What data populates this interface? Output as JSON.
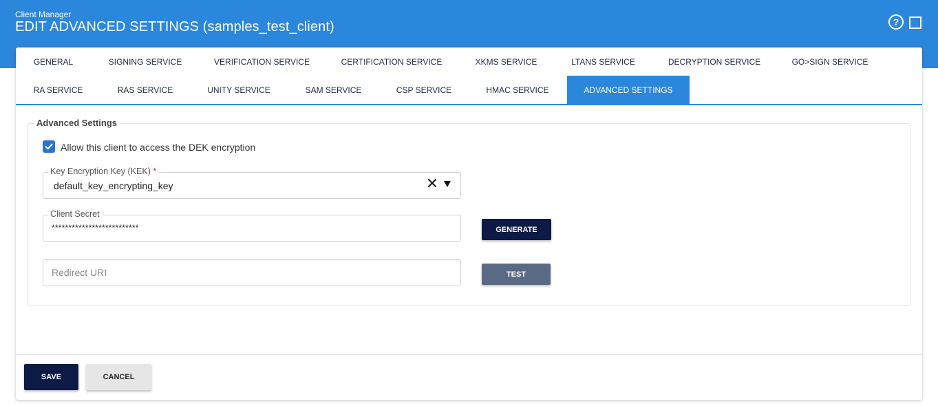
{
  "header": {
    "app_name": "Client Manager",
    "title": "EDIT ADVANCED SETTINGS (samples_test_client)",
    "help_icon": "?"
  },
  "tabs": [
    {
      "label": "GENERAL"
    },
    {
      "label": "SIGNING SERVICE"
    },
    {
      "label": "VERIFICATION SERVICE"
    },
    {
      "label": "CERTIFICATION SERVICE"
    },
    {
      "label": "XKMS SERVICE"
    },
    {
      "label": "LTANS SERVICE"
    },
    {
      "label": "DECRYPTION SERVICE"
    },
    {
      "label": "GO>SIGN SERVICE"
    },
    {
      "label": "RA SERVICE"
    },
    {
      "label": "RAS SERVICE"
    },
    {
      "label": "UNITY SERVICE"
    },
    {
      "label": "SAM SERVICE"
    },
    {
      "label": "CSP SERVICE"
    },
    {
      "label": "HMAC SERVICE"
    },
    {
      "label": "ADVANCED SETTINGS",
      "active": true
    }
  ],
  "section": {
    "legend": "Advanced Settings",
    "dek_checkbox": {
      "label": "Allow this client to access the DEK encryption",
      "checked": true
    },
    "kek": {
      "label": "Key Encryption Key (KEK)",
      "required_mark": "*",
      "value": "default_key_encrypting_key"
    },
    "client_secret": {
      "label": "Client Secret",
      "value": "**************************"
    },
    "redirect_uri": {
      "placeholder": "Redirect URI",
      "value": ""
    },
    "generate_label": "GENERATE",
    "test_label": "TEST"
  },
  "footer": {
    "save_label": "SAVE",
    "cancel_label": "CANCEL"
  },
  "colors": {
    "header_blue": "#2b87db",
    "dark_navy": "#0c1a45",
    "disabled_button": "#5b6a84",
    "checkbox_blue": "#2b73d0"
  }
}
